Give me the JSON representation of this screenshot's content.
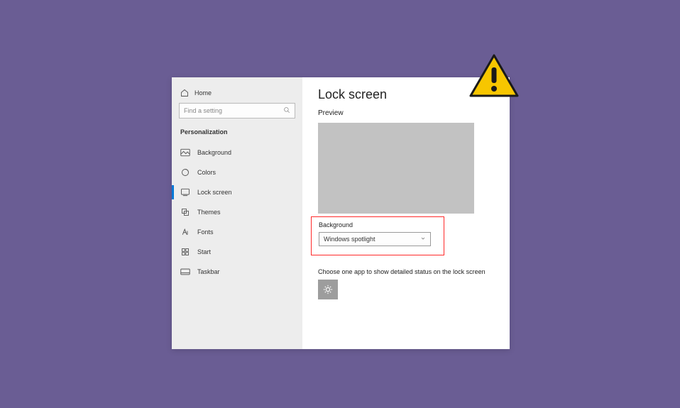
{
  "sidebar": {
    "home_label": "Home",
    "search_placeholder": "Find a setting",
    "section_title": "Personalization",
    "items": [
      {
        "label": "Background"
      },
      {
        "label": "Colors"
      },
      {
        "label": "Lock screen"
      },
      {
        "label": "Themes"
      },
      {
        "label": "Fonts"
      },
      {
        "label": "Start"
      },
      {
        "label": "Taskbar"
      }
    ]
  },
  "main": {
    "page_title": "Lock screen",
    "preview_label": "Preview",
    "bg_label": "Background",
    "bg_selected": "Windows spotlight",
    "app_label": "Choose one app to show detailed status on the lock screen"
  }
}
